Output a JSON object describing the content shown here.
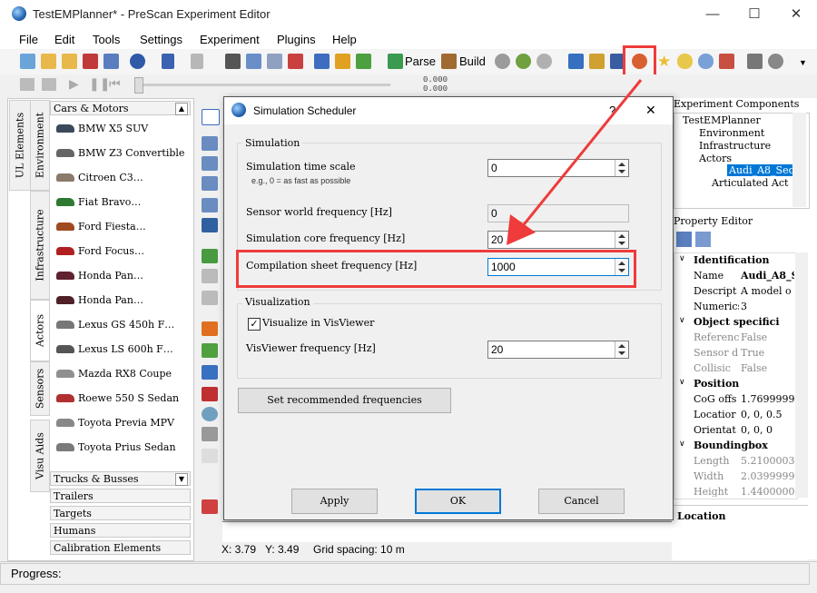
{
  "window": {
    "title": "TestEMPlanner* - PreScan Experiment Editor"
  },
  "menu": [
    "File",
    "Edit",
    "Tools",
    "Settings",
    "Experiment",
    "Plugins",
    "Help"
  ],
  "toolbar": {
    "parse_label": "Parse",
    "build_label": "Build"
  },
  "sim_counter": {
    "top": "0.000",
    "bottom": "0.000"
  },
  "left_tabs": [
    "UL Elements",
    "Environment",
    "Infrastructure",
    "Actors",
    "Sensors",
    "Visu Aids"
  ],
  "library": {
    "header": "Cars & Motors",
    "cars": [
      "BMW X5 SUV",
      "BMW Z3 Convertible",
      "Citroen C3…",
      "Fiat Bravo…",
      "Ford Fiesta…",
      "Ford Focus…",
      "Honda Pan…",
      "Honda Pan…",
      "Lexus GS 450h F…",
      "Lexus LS 600h F…",
      "Mazda RX8 Coupe",
      "Roewe 550 S Sedan",
      "Toyota Previa MPV",
      "Toyota Prius Sedan"
    ],
    "categories": [
      "Trucks & Busses",
      "Trailers",
      "Targets",
      "Humans",
      "Calibration Elements"
    ]
  },
  "canvas": {
    "x_label": "X: 3.79",
    "y_label": "Y: 3.49",
    "grid_label": "Grid spacing: 10 m"
  },
  "experiment_components": {
    "title": "Experiment Components",
    "tree": [
      "TestEMPlanner",
      "Environment",
      "Infrastructure",
      "Actors",
      "Audi_A8_Seda",
      "Articulated Act"
    ]
  },
  "property_editor": {
    "title": "Property Editor",
    "rows": [
      {
        "name": "Identification",
        "value": "",
        "kind": "section"
      },
      {
        "name": "Name",
        "value": "Audi_A8_S",
        "kind": "prop"
      },
      {
        "name": "Descript",
        "value": "A model o",
        "kind": "prop"
      },
      {
        "name": "Numerics",
        "value": "3",
        "kind": "prop"
      },
      {
        "name": "Object specifici",
        "value": "",
        "kind": "section"
      },
      {
        "name": "Referenc",
        "value": "False",
        "kind": "grey"
      },
      {
        "name": "Sensor d",
        "value": "True",
        "kind": "grey"
      },
      {
        "name": "Collisic",
        "value": "False",
        "kind": "grey"
      },
      {
        "name": "Position",
        "value": "",
        "kind": "section"
      },
      {
        "name": "CoG offs",
        "value": "1.7699999",
        "kind": "prop"
      },
      {
        "name": "Locatior",
        "value": "0, 0, 0.5",
        "kind": "prop"
      },
      {
        "name": "Orientat",
        "value": "0, 0, 0",
        "kind": "prop"
      },
      {
        "name": "Boundingbox",
        "value": "",
        "kind": "section"
      },
      {
        "name": "Length",
        "value": "5.2100003",
        "kind": "grey"
      },
      {
        "name": "Width",
        "value": "2.0399999",
        "kind": "grey"
      },
      {
        "name": "Height",
        "value": "1.4400000",
        "kind": "grey"
      }
    ],
    "location_label": "Location"
  },
  "status": {
    "progress_label": "Progress:"
  },
  "dialog": {
    "title": "Simulation Scheduler",
    "help": "?",
    "close": "✕",
    "simulation_group": "Simulation",
    "time_scale_label": "Simulation time scale",
    "time_scale_hint": "e.g., 0 = as fast as possible",
    "time_scale_value": "0",
    "sensor_freq_label": "Sensor world frequency [Hz]",
    "sensor_freq_value": "0",
    "core_freq_label": "Simulation core frequency [Hz]",
    "core_freq_value": "20",
    "compilation_freq_label": "Compilation sheet frequency [Hz]",
    "compilation_freq_value": "1000",
    "visualization_group": "Visualization",
    "visualize_label": "Visualize in VisViewer",
    "visualize_checked": true,
    "visviewer_freq_label": "VisViewer frequency [Hz]",
    "visviewer_freq_value": "20",
    "recommended_button": "Set recommended frequencies",
    "apply_button": "Apply",
    "ok_button": "OK",
    "cancel_button": "Cancel"
  },
  "colors": {
    "highlight": "#ef3b3b",
    "selection": "#0078d7"
  }
}
